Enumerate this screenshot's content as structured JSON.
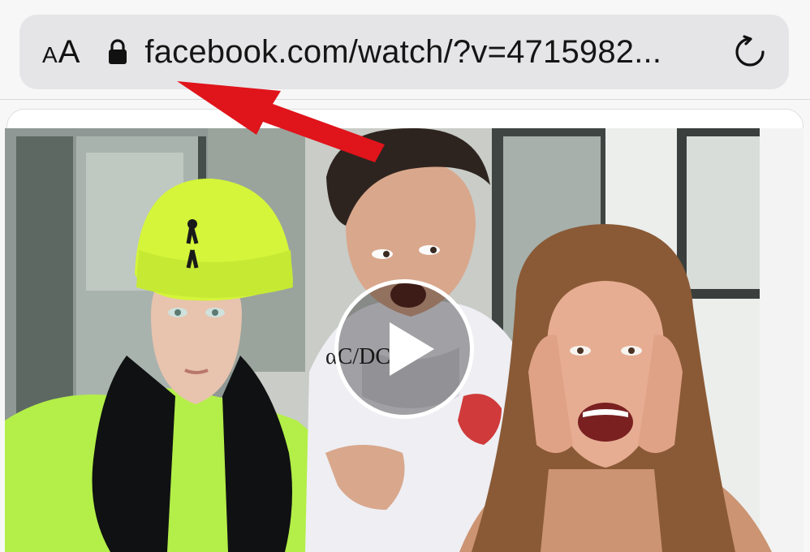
{
  "browser": {
    "reader_small": "A",
    "reader_large": "A",
    "url": "facebook.com/watch/?v=4715982...",
    "icons": {
      "lock": "lock-icon",
      "reload": "reload-icon"
    }
  },
  "video": {
    "play_icon": "play-icon"
  },
  "colors": {
    "address_bar": "#e5e5e7",
    "arrow": "#e0141b",
    "beanie": "#d4f53a",
    "hoodie": "#b7f04a"
  }
}
